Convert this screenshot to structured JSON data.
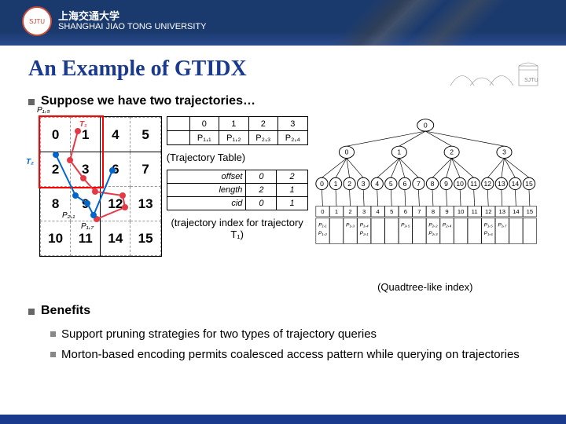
{
  "banner": {
    "uni_cn": "上海交通大学",
    "uni_en": "SHANGHAI JIAO TONG UNIVERSITY"
  },
  "title": "An Example of GTIDX",
  "suppose": "Suppose we have two trajectories…",
  "grid": {
    "cells": [
      [
        "0",
        "1",
        "4",
        "5"
      ],
      [
        "2",
        "3",
        "6",
        "7"
      ],
      [
        "8",
        "9",
        "12",
        "13"
      ],
      [
        "10",
        "11",
        "14",
        "15"
      ]
    ]
  },
  "traj_labels": {
    "p11": "P₁,₅",
    "t1": "T₁",
    "t2": "T₂",
    "p21": "P₂,₁",
    "p17": "P₁,₇"
  },
  "traj_table": {
    "caption": "(Trajectory Table)",
    "header": [
      "",
      "0",
      "1",
      "2",
      "3"
    ],
    "row": [
      "",
      "P₁,₁",
      "P₁,₂",
      "P₂,₃",
      "P₂,₄"
    ]
  },
  "idx_table": {
    "rows": [
      [
        "offset",
        "0",
        "2"
      ],
      [
        "length",
        "2",
        "1"
      ],
      [
        "cid",
        "0",
        "1"
      ]
    ],
    "caption": "(trajectory index for trajectory T₁)"
  },
  "tree": {
    "caption": "(Quadtree-like index)",
    "root": "0",
    "l1": [
      "0",
      "1",
      "2",
      "3"
    ],
    "l2": [
      "0",
      "1",
      "2",
      "3",
      "4",
      "5",
      "6",
      "7",
      "8",
      "9",
      "10",
      "11",
      "12",
      "13",
      "14",
      "15"
    ],
    "leaves_idx": [
      "0",
      "1",
      "2",
      "3",
      "4",
      "5",
      "6",
      "7",
      "8",
      "9",
      "10",
      "11",
      "12",
      "13",
      "14",
      "15"
    ],
    "leaves_p": [
      "P₁,₁\nP₁,₂",
      "",
      "P₁,₃",
      "P₁,₄\nP₂,₁",
      "",
      "",
      "P₂,₅",
      "",
      "P₂,₂\nP₂,₃",
      "P₂,₄",
      "",
      "",
      "P₁,₅\nP₁,₆",
      "P₁,₇",
      "",
      ""
    ]
  },
  "benefits": {
    "title": "Benefits",
    "items": [
      "Support pruning strategies for two types of trajectory queries",
      "Morton-based encoding permits coalesced access pattern while querying on trajectories"
    ]
  }
}
